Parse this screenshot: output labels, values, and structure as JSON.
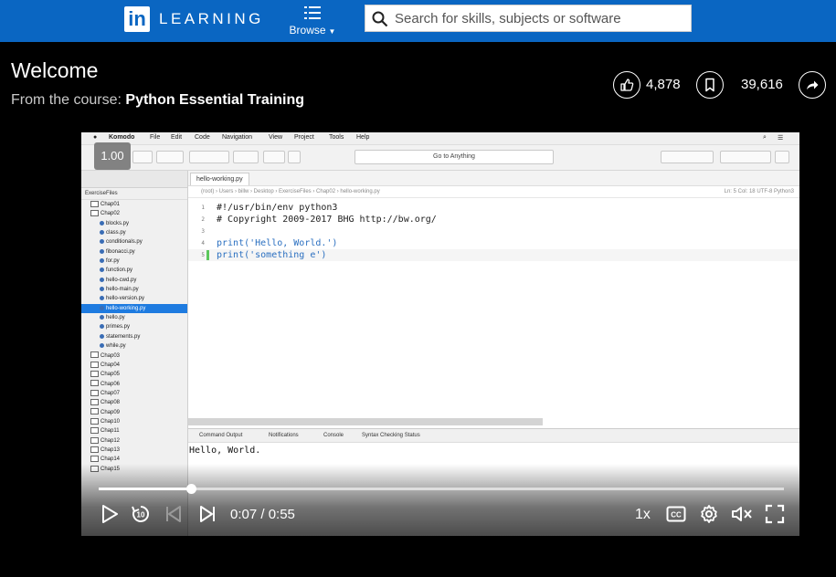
{
  "topbar": {
    "logo_mark": "in",
    "logo_text": "LEARNING",
    "browse_label": "Browse",
    "search_placeholder": "Search for skills, subjects or software",
    "color": "#0a66c2"
  },
  "header": {
    "title": "Welcome",
    "course_prefix": "From the course:",
    "course_name": "Python Essential Training",
    "like_count": "4,878",
    "save_count": "39,616"
  },
  "video": {
    "speed_badge": "1.00",
    "ide": {
      "menu": [
        "Komodo",
        "File",
        "Edit",
        "Code",
        "Navigation",
        "View",
        "Project",
        "Tools",
        "Help"
      ],
      "goto_label": "Go to Anything",
      "sidebar_header": "ExerciseFiles",
      "tree": [
        {
          "label": "Chap01",
          "type": "folder"
        },
        {
          "label": "Chap02",
          "type": "folder"
        },
        {
          "label": "blocks.py",
          "type": "file"
        },
        {
          "label": "class.py",
          "type": "file"
        },
        {
          "label": "conditionals.py",
          "type": "file"
        },
        {
          "label": "fibonacci.py",
          "type": "file"
        },
        {
          "label": "for.py",
          "type": "file"
        },
        {
          "label": "function.py",
          "type": "file"
        },
        {
          "label": "hello-cwd.py",
          "type": "file"
        },
        {
          "label": "hello-main.py",
          "type": "file"
        },
        {
          "label": "hello-version.py",
          "type": "file"
        },
        {
          "label": "hello-working.py",
          "type": "file",
          "selected": true
        },
        {
          "label": "hello.py",
          "type": "file"
        },
        {
          "label": "primes.py",
          "type": "file"
        },
        {
          "label": "statements.py",
          "type": "file"
        },
        {
          "label": "while.py",
          "type": "file"
        },
        {
          "label": "Chap03",
          "type": "folder"
        },
        {
          "label": "Chap04",
          "type": "folder"
        },
        {
          "label": "Chap05",
          "type": "folder"
        },
        {
          "label": "Chap06",
          "type": "folder"
        },
        {
          "label": "Chap07",
          "type": "folder"
        },
        {
          "label": "Chap08",
          "type": "folder"
        },
        {
          "label": "Chap09",
          "type": "folder"
        },
        {
          "label": "Chap10",
          "type": "folder"
        },
        {
          "label": "Chap11",
          "type": "folder"
        },
        {
          "label": "Chap12",
          "type": "folder"
        },
        {
          "label": "Chap13",
          "type": "folder"
        },
        {
          "label": "Chap14",
          "type": "folder"
        },
        {
          "label": "Chap15",
          "type": "folder"
        }
      ],
      "editor_tab": "hello-working.py",
      "breadcrumb": "(root) › Users › billw › Desktop › ExerciseFiles › Chap02 › hello-working.py",
      "cursor_info": "Ln: 5 Col: 18   UTF-8   Python3",
      "code_lines": [
        {
          "num": "1",
          "text": "#!/usr/bin/env python3",
          "color": "#222222"
        },
        {
          "num": "2",
          "text": "# Copyright 2009-2017 BHG http://bw.org/",
          "color": "#222222"
        },
        {
          "num": "3",
          "text": "",
          "color": "#222222"
        },
        {
          "num": "4",
          "text": "print('Hello, World.')",
          "color": "#2a6fc0"
        },
        {
          "num": "5",
          "text": "print('something e')",
          "color": "#2a6fc0"
        }
      ],
      "panel_tabs": [
        "Command Output",
        "Notifications",
        "Console",
        "Syntax Checking Status"
      ],
      "panel_output": "Hello, World."
    }
  },
  "controls": {
    "current_time": "0:07",
    "duration": "0:55",
    "time_display": "0:07 / 0:55",
    "progress": 0.135,
    "playback_rate": "1x",
    "icons": [
      "play-icon",
      "replay-10-icon",
      "previous-icon",
      "next-icon",
      "captions-icon",
      "settings-icon",
      "mute-icon",
      "fullscreen-icon"
    ]
  }
}
